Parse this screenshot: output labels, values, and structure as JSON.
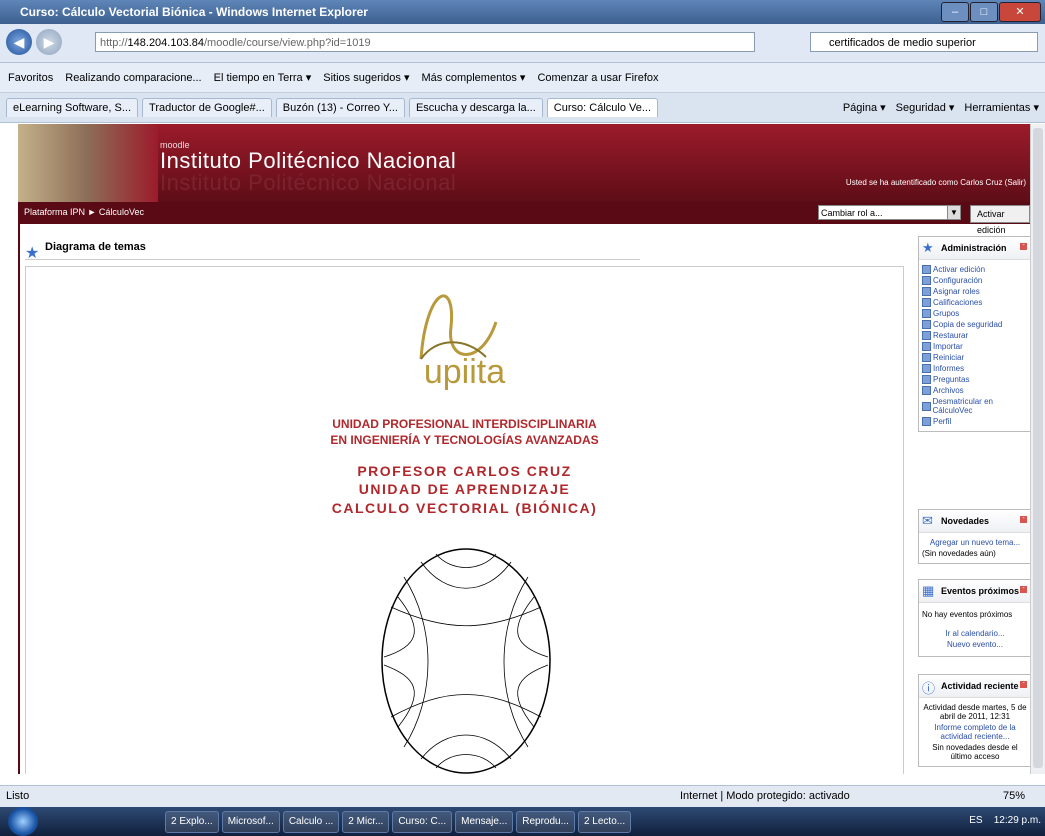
{
  "window": {
    "title": "Curso: Cálculo Vectorial Biónica - Windows Internet Explorer"
  },
  "address": {
    "url_prefix": "http://",
    "url_host": "148.204.103.84",
    "url_path": "/moodle/course/view.php?id=1019",
    "search_text": "certificados de medio superior"
  },
  "favorites": [
    "Favoritos",
    "Realizando comparacione...",
    "El tiempo en Terra ▾",
    "Sitios sugeridos ▾",
    "Más complementos ▾",
    "Comenzar a usar Firefox"
  ],
  "tabs": [
    "eLearning Software, S...",
    "Traductor de Google#...",
    "Buzón (13) - Correo Y...",
    "Escucha y descarga la...",
    "Curso: Cálculo Ve..."
  ],
  "tools": [
    "Página ▾",
    "Seguridad ▾",
    "Herramientas ▾"
  ],
  "moodle": {
    "brand_small": "moodle",
    "institution": "Instituto Politécnico Nacional",
    "logged_in": "Usted se ha autentificado como Carlos Cruz (Salir)",
    "breadcrumb": "Plataforma IPN ► CálculoVec",
    "role_select": "Cambiar rol a...",
    "edit_button": "Activar edición"
  },
  "main": {
    "heading": "Diagrama de temas",
    "logo_text": "upiita",
    "line1": "UNIDAD PROFESIONAL INTERDISCIPLINARIA",
    "line2": "EN INGENIERÍA Y TECNOLOGÍAS AVANZADAS",
    "line3": "PROFESOR CARLOS CRUZ",
    "line4": "UNIDAD DE APRENDIZAJE",
    "line5": "CALCULO VECTORIAL  (BIÓNICA)"
  },
  "admin": {
    "title": "Administración",
    "items": [
      "Activar edición",
      "Configuración",
      "Asignar roles",
      "Calificaciones",
      "Grupos",
      "Copia de seguridad",
      "Restaurar",
      "Importar",
      "Reiniciar",
      "Informes",
      "Preguntas",
      "Archivos",
      "Desmatricular en CálculoVec",
      "Perfil"
    ]
  },
  "news": {
    "title": "Novedades",
    "link": "Agregar un nuevo tema...",
    "empty": "(Sin novedades aún)"
  },
  "events": {
    "title": "Eventos próximos",
    "none": "No hay eventos próximos",
    "calendar": "Ir al calendario...",
    "new_event": "Nuevo evento..."
  },
  "activity": {
    "title": "Actividad reciente",
    "since": "Actividad desde martes, 5 de abril de 2011, 12:31",
    "full_report": "Informe completo de la actividad reciente...",
    "none": "Sin novedades desde el último acceso"
  },
  "status": {
    "left": "Listo",
    "zone": "Internet | Modo protegido: activado",
    "zoom": "75%"
  },
  "taskbar": {
    "items": [
      "2 Explo...",
      "Microsof...",
      "Calculo ...",
      "2 Micr...",
      "Curso: C...",
      "Mensaje...",
      "Reprodu...",
      "2 Lecto..."
    ],
    "lang": "ES",
    "time": "12:29 p.m."
  }
}
